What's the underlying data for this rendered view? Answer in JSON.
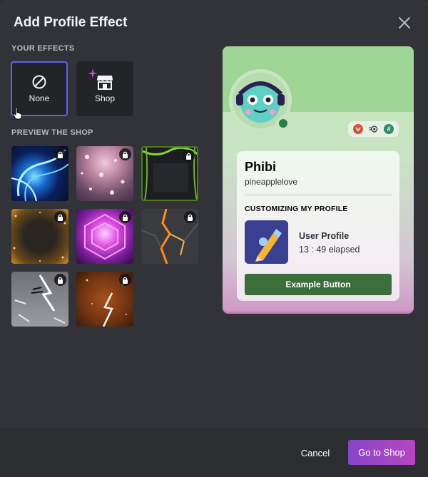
{
  "modal": {
    "title": "Add Profile Effect"
  },
  "your_effects": {
    "label": "YOUR EFFECTS",
    "items": [
      {
        "label": "None",
        "icon": "none-icon",
        "selected": true
      },
      {
        "label": "Shop",
        "icon": "shop-icon",
        "selected": false
      }
    ]
  },
  "preview_shop": {
    "label": "PREVIEW THE SHOP",
    "items": [
      {
        "name": "blue-energy-swirl",
        "locked": true
      },
      {
        "name": "pink-sparkle-bokeh",
        "locked": true
      },
      {
        "name": "green-vine-frame",
        "locked": true
      },
      {
        "name": "golden-ember-sparks",
        "locked": true
      },
      {
        "name": "magenta-hexagon-glow",
        "locked": true
      },
      {
        "name": "lava-cracks",
        "locked": true
      },
      {
        "name": "manga-action-lines",
        "locked": true
      },
      {
        "name": "orange-lightning-storm",
        "locked": true
      }
    ]
  },
  "profile": {
    "display_name": "Phibi",
    "username": "pineapplelove",
    "status_color": "#248046",
    "badges": [
      "hypesquad-badge",
      "nitro-boost-badge",
      "hashtag-badge"
    ],
    "section_heading": "CUSTOMIZING MY PROFILE",
    "activity_name": "User Profile",
    "activity_time": "13 : 49 elapsed",
    "example_button": "Example Button"
  },
  "footer": {
    "cancel_label": "Cancel",
    "go_to_shop_label": "Go to Shop"
  },
  "colors": {
    "selected_border": "#5865f2",
    "primary_gradient_start": "#8547c6",
    "primary_gradient_end": "#b845c1",
    "example_button": "#3c6e3a"
  }
}
